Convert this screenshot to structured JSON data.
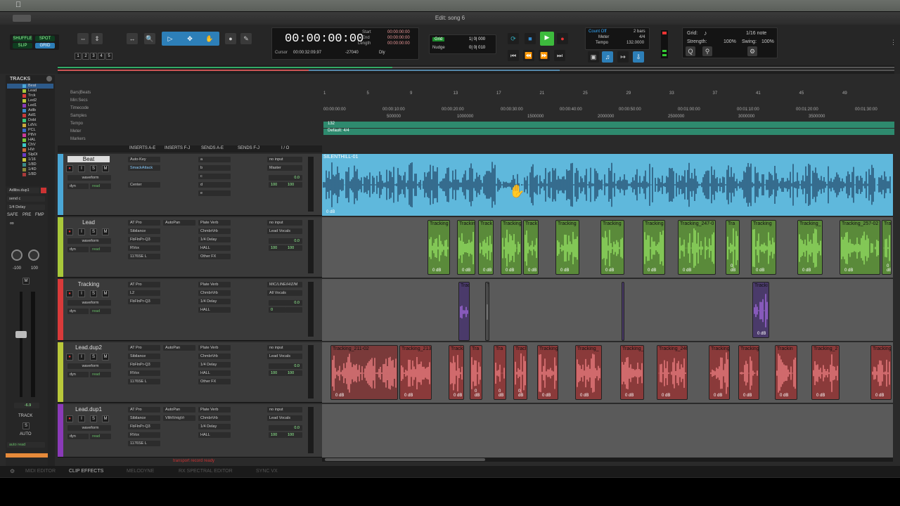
{
  "window_title": "Edit: song 6",
  "edit_modes": [
    "SHUFFLE",
    "SPOT",
    "SLIP",
    "GRID"
  ],
  "grid_nums": [
    "1",
    "2",
    "3",
    "4",
    "5"
  ],
  "counter": {
    "main": "00:00:00:00",
    "start_label": "Start",
    "end_label": "End",
    "length_label": "Length",
    "start": "00:00:00:00",
    "end": "00:00:00:00",
    "length": "00:00:00:00",
    "cursor_label": "Cursor",
    "cursor": "00:00:32:09.97",
    "cursor_value": "-27040",
    "dly": "Dly"
  },
  "grid_nudge": {
    "grid_label": "Grid",
    "grid": "1| 0| 000",
    "nudge_label": "Nudge",
    "nudge": "0| 0| 010"
  },
  "transport_info": {
    "count_off": "Count Off",
    "bars": "2 bars",
    "meter_label": "Meter",
    "meter": "4/4",
    "tempo_label": "Tempo",
    "tempo": "132.0000"
  },
  "grid_settings": {
    "grid_label": "Grid:",
    "grid_value": "1/16 note",
    "strength_label": "Strength:",
    "strength": "100%",
    "swing_label": "Swing:",
    "swing": "100%"
  },
  "tracks_panel": {
    "title": "TRACKS",
    "items": [
      "Beat",
      "Lead",
      "Trck",
      "Led2",
      "Led1",
      "Adlb",
      "Adl1",
      "Dobl",
      "LdVc",
      "PCL",
      "PllVr",
      "HAL",
      "ChV",
      "HVr",
      "SlpDl",
      "1/16",
      "1/8D",
      "1/4D",
      "1/8D"
    ]
  },
  "timeline": {
    "rulers": [
      "Bars|Beats",
      "Min:Secs",
      "Timecode",
      "Samples",
      "Tempo",
      "Meter",
      "Markers"
    ],
    "bars": [
      "1",
      "5",
      "9",
      "13",
      "17",
      "21",
      "25",
      "29",
      "33",
      "37",
      "41",
      "45",
      "49"
    ],
    "timecodes": [
      "00:00:00:00",
      "00:00:10:00",
      "00:00:20:00",
      "00:00:30:00",
      "00:00:40:00",
      "00:00:50:00",
      "00:01:00:00",
      "00:01:10:00",
      "00:01:20:00",
      "00:01:30:00"
    ],
    "samples": [
      "500000",
      "1000000",
      "1500000",
      "2000000",
      "2500000",
      "3000000",
      "3500000"
    ],
    "tempo_marker": "132",
    "meter_marker": "Default: 4/4"
  },
  "column_headers": [
    "INSERTS A-E",
    "INSERTS F-J",
    "SENDS A-E",
    "SENDS F-J",
    "I / O"
  ],
  "tracks": [
    {
      "name": "Beat",
      "color": "#4aa7d6",
      "inserts": [
        "Auto-Key",
        "SmackAttack",
        "",
        "Center"
      ],
      "sends": [
        "a",
        "b",
        "c",
        "d",
        "e"
      ],
      "input": "no input",
      "output": "Master",
      "vol": "0.0",
      "pan": "100",
      "panr": "100",
      "view": "waveform",
      "dyn": "dyn",
      "read": "read"
    },
    {
      "name": "Lead",
      "color": "#a8c83a",
      "inserts": [
        "AT Pro",
        "Sibilance",
        "FbFlnPr-Q3",
        "RVox",
        "1176SE L"
      ],
      "inserts2": [
        "AutoPan"
      ],
      "sends": [
        "Plate Verb",
        "ChmbrVrb",
        "1/4 Delay",
        "HALL",
        "Other FX"
      ],
      "input": "no input",
      "output": "Lead Vocals",
      "vol": "0.0",
      "pan": "100",
      "panr": "100",
      "view": "waveform",
      "dyn": "dyn",
      "read": "read"
    },
    {
      "name": "Tracking",
      "color": "#d93a3a",
      "inserts": [
        "AT Pro",
        "L2",
        "FbFlnPr-Q3"
      ],
      "sends": [
        "Plate Verb",
        "ChmbrVrb",
        "1/4 Delay",
        "HALL"
      ],
      "input": "MIC/LINE/HIZ/M",
      "output": "All Vocals",
      "vol": "0.0",
      "pan": "0",
      "panr": "",
      "view": "waveform",
      "dyn": "dyn",
      "read": "read"
    },
    {
      "name": "Lead.dup2",
      "color": "#b9c83a",
      "inserts": [
        "AT Pro",
        "Sibilance",
        "FbFlnPr-Q3",
        "RVox",
        "1176SE L"
      ],
      "inserts2": [
        "AutoPan"
      ],
      "sends": [
        "Plate Verb",
        "ChmbrVrb",
        "1/4 Delay",
        "HALL",
        "Other FX"
      ],
      "input": "no input",
      "output": "Lead Vocals",
      "vol": "0.0",
      "pan": "100",
      "panr": "100",
      "view": "waveform",
      "dyn": "dyn",
      "read": "read"
    },
    {
      "name": "Lead.dup1",
      "color": "#8a3ab8",
      "inserts": [
        "AT Pro",
        "Sibilance",
        "FbFlnPr-Q3",
        "RVox",
        "1176SE L"
      ],
      "inserts2": [
        "AutoPan",
        "VlthlVntgVr"
      ],
      "sends": [
        "Plate Verb",
        "ChmbrVrb",
        "1/4 Delay",
        "HALL"
      ],
      "input": "no input",
      "output": "Lead Vocals",
      "vol": "0.0",
      "pan": "100",
      "panr": "100",
      "view": "waveform",
      "dyn": "dyn",
      "read": "read"
    }
  ],
  "clips": {
    "beat": {
      "name": "SILENTHILL-01",
      "db": "0 dB"
    },
    "lead": [
      "Tracking",
      "Trackin",
      "Track",
      "Tracking",
      "Track",
      "Tracking",
      "Tracking",
      "Tracking",
      "Tracking_247-0",
      "Tra",
      "Tracking",
      "Tracking_",
      "Tracking_257-02",
      "Tra"
    ],
    "tracking": [
      "Trac",
      "T",
      "Tracki"
    ],
    "dup2": [
      "Tracking_211-02",
      "Tracking_213",
      "Tracki",
      "Tra",
      "Tra",
      "Tracl",
      "Tracking",
      "Tracking_",
      "Tracking_",
      "Tracking_246",
      "Tracking",
      "Tracking",
      "Trackin",
      "Tracking_2",
      "Tracking"
    ],
    "db": "0 dB"
  },
  "left_strip": {
    "track_name": "Adlibs.dup1",
    "send": "send c",
    "delay": "1/4 Delay",
    "safe": "SAFE",
    "pre": "PRE",
    "fmp": "FMP",
    "pan_l": "-100",
    "pan_r": "100",
    "m": "M",
    "fader_val": "-6.9",
    "track_label": "TRACK",
    "s": "S",
    "auto": "AUTO",
    "auto_mode": "auto read"
  },
  "status": "transport record ready",
  "bottom_tabs": [
    "MIDI EDITOR",
    "CLIP EFFECTS",
    "MELODYNE",
    "RX SPECTRAL EDITOR",
    "SYNC VX"
  ],
  "colors": {
    "beat": "#5fb8dc",
    "lead": "#6cbf3a",
    "tracking": "#8a4ec0",
    "dup2": "#e06a6e",
    "accent": "#2d7fb8"
  }
}
